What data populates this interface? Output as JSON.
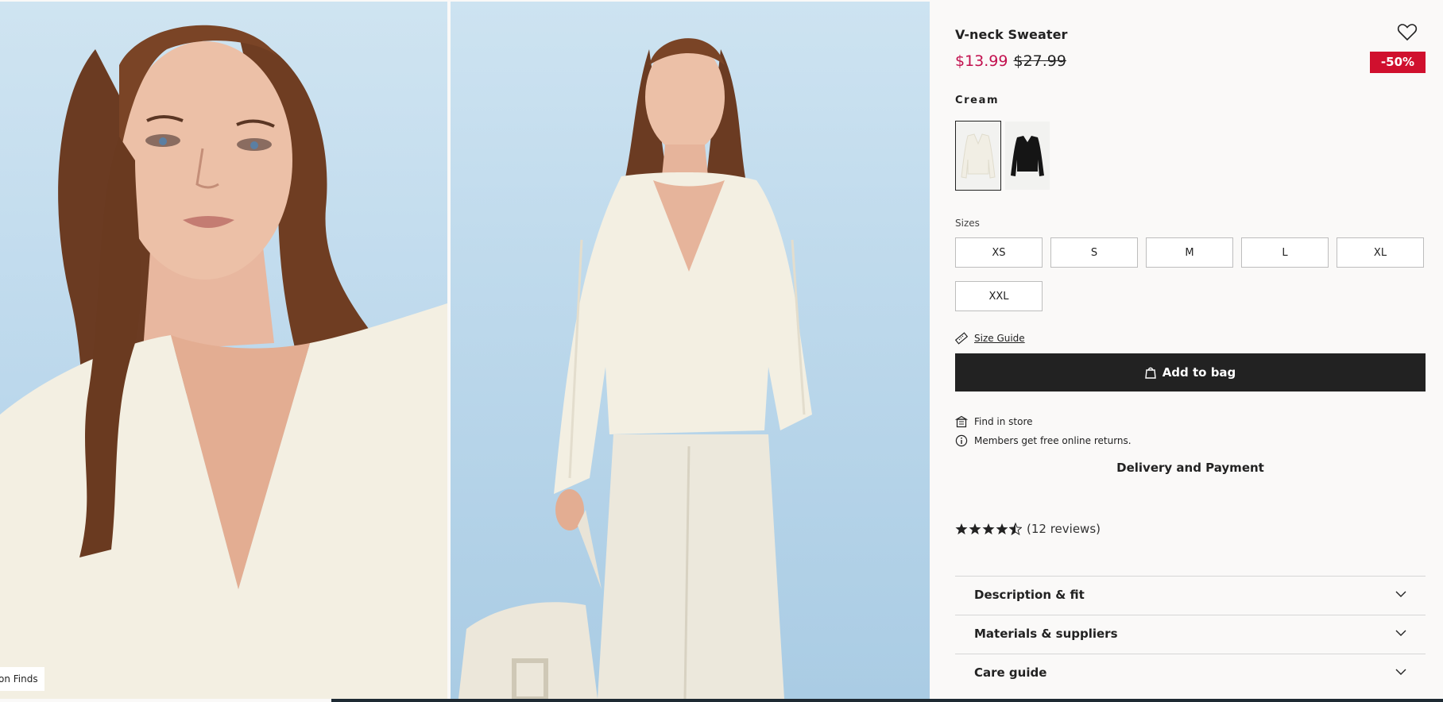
{
  "gallery": {
    "photo_tag": "on Finds"
  },
  "product": {
    "title": "V-neck Sweater",
    "price_sale": "$13.99",
    "price_original": "$27.99",
    "discount_badge": "-50%",
    "color_name": "Cream",
    "swatches": [
      {
        "name": "Cream",
        "color": "#f1eee4",
        "selected": true
      },
      {
        "name": "Black",
        "color": "#151515",
        "selected": false
      }
    ],
    "sizes_label": "Sizes",
    "sizes": [
      "XS",
      "S",
      "M",
      "L",
      "XL",
      "XXL"
    ],
    "size_guide": "Size Guide",
    "add_to_bag": "Add to bag",
    "find_in_store": "Find in store",
    "members_note": "Members get free online returns.",
    "delivery": "Delivery and Payment",
    "rating": 4.5,
    "reviews": "(12 reviews)",
    "accordions": [
      "Description & fit",
      "Materials & suppliers",
      "Care guide"
    ]
  },
  "colors": {
    "sale_price": "#c2104e",
    "badge": "#d0102e",
    "primary_button": "#222222",
    "background": "#faf9f8"
  },
  "icons": {
    "wishlist": "heart-icon",
    "size_guide": "ruler-icon",
    "bag": "bag-icon",
    "store": "store-icon",
    "info": "info-icon",
    "chevron": "chevron-down-icon",
    "star": "star-icon"
  }
}
